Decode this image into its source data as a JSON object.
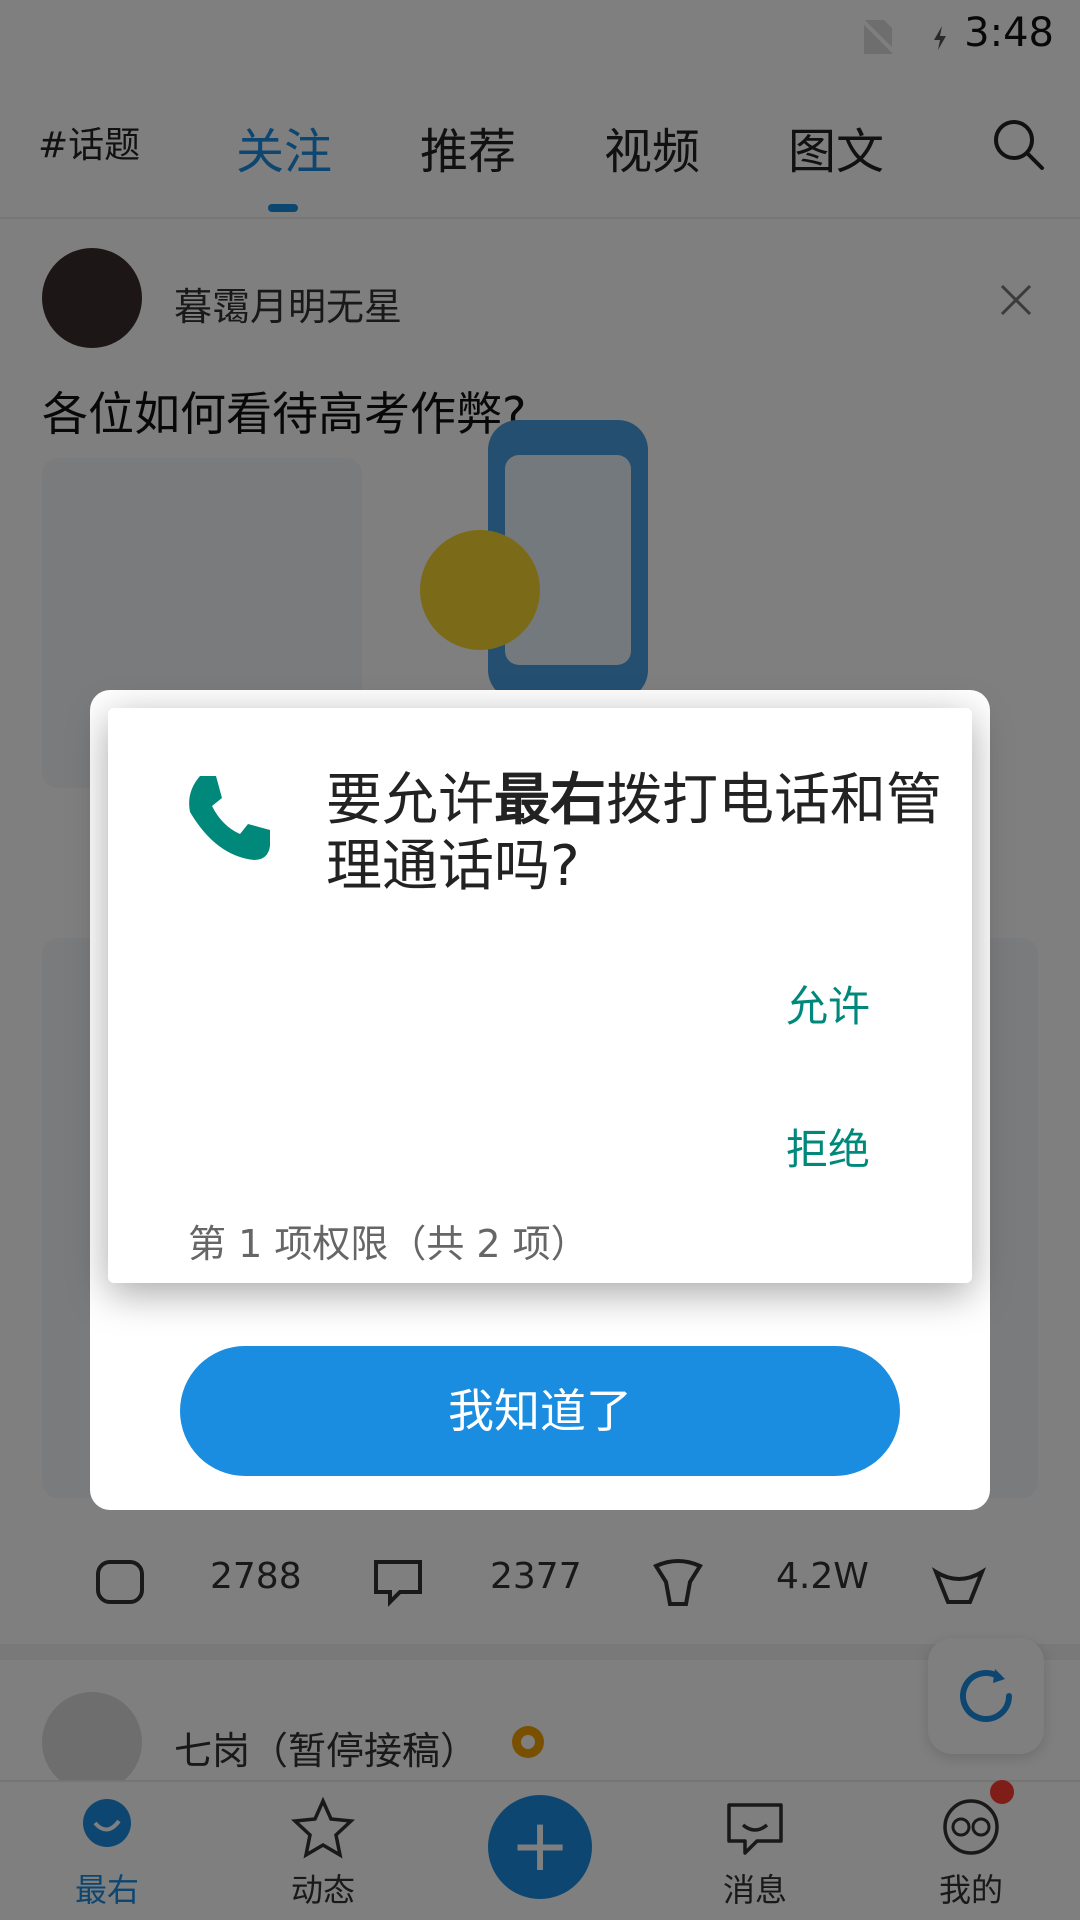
{
  "status_bar": {
    "time": "3:48"
  },
  "top_tabs": {
    "topic": "#话题",
    "tabs": [
      "关注",
      "推荐",
      "视频",
      "图文"
    ],
    "active": "关注"
  },
  "feed": {
    "post1": {
      "user": "暮霭月明无星",
      "title": "各位如何看待高考作弊?"
    },
    "stats": {
      "shares": "2788",
      "comments": "2377",
      "likes": "4.2W"
    },
    "post2": {
      "user": "七岗（暂停接稿）"
    }
  },
  "popup": {
    "got_it": "我知道了"
  },
  "dialog": {
    "title_prefix": "要允许",
    "app_name": "最右",
    "title_suffix": "拨打电话和管理通话吗?",
    "allow": "允许",
    "deny": "拒绝",
    "footer": "第 1 项权限（共 2 项）",
    "accent_color": "#00897b"
  },
  "bottom_nav": {
    "items": [
      "最右",
      "动态",
      "消息",
      "我的"
    ],
    "active": "最右"
  },
  "colors": {
    "brand_blue": "#1b8de0"
  }
}
